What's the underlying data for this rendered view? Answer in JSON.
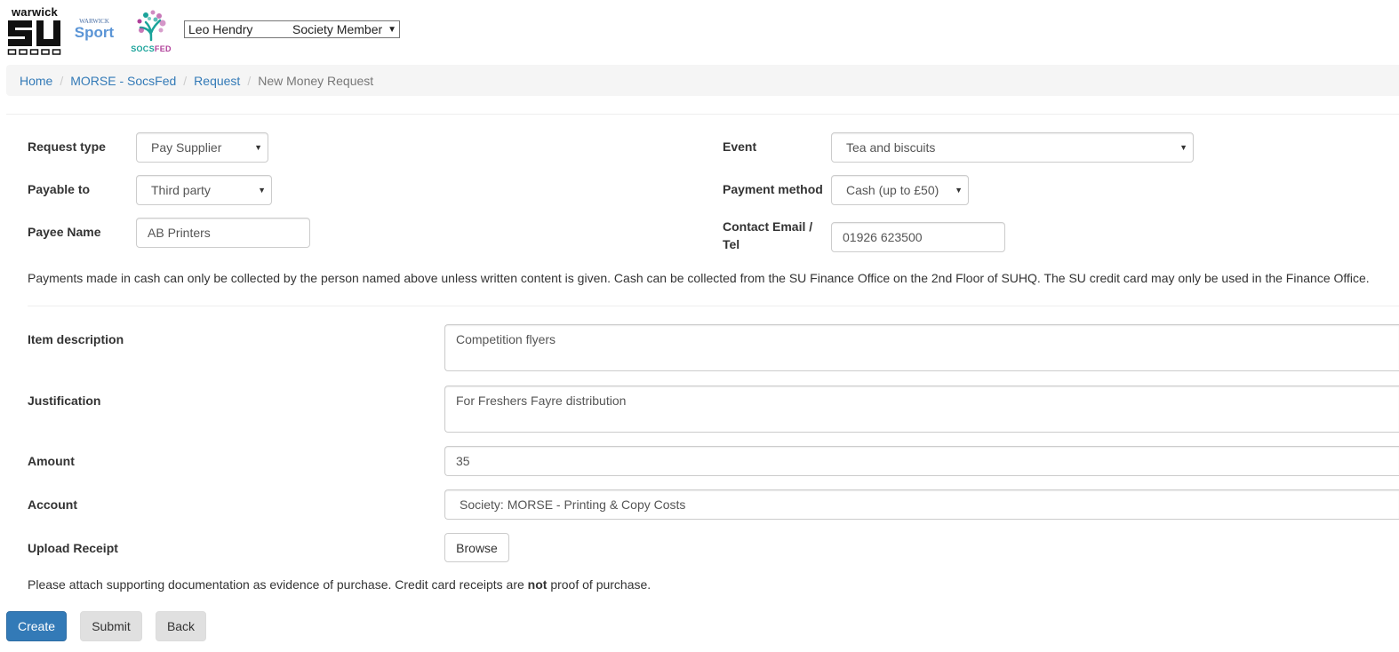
{
  "header": {
    "logos": {
      "su": {
        "top_text": "warwick",
        "main_text": "SU"
      },
      "sport": {
        "top_text": "WARWICK",
        "main_text": "Sport"
      },
      "socsfed": {
        "text_a": "SOCS",
        "text_b": "FED",
        "color_a": "#1aa39a",
        "color_b": "#b0409a"
      }
    },
    "user_select": {
      "name": "Leo Hendry",
      "role": "Society Member"
    }
  },
  "breadcrumb": {
    "items": [
      "Home",
      "MORSE - SocsFed",
      "Request"
    ],
    "active": "New Money Request",
    "separator": "/"
  },
  "form": {
    "request_type": {
      "label": "Request type",
      "value": "Pay Supplier"
    },
    "payable_to": {
      "label": "Payable to",
      "value": "Third party"
    },
    "payee_name": {
      "label": "Payee Name",
      "value": "AB Printers"
    },
    "event": {
      "label": "Event",
      "value": "Tea and biscuits"
    },
    "payment_method": {
      "label": "Payment method",
      "value": "Cash (up to £50)"
    },
    "contact": {
      "label_line1": "Contact Email /",
      "label_line2": "Tel",
      "value": "01926 623500"
    },
    "cash_note": "Payments made in cash can only be collected by the person named above unless written content is given. Cash can be collected from the SU Finance Office on the 2nd Floor of SUHQ. The SU credit card may only be used in the Finance Office.",
    "item_description": {
      "label": "Item description",
      "value": "Competition flyers"
    },
    "justification": {
      "label": "Justification",
      "value": "For Freshers Fayre distribution"
    },
    "amount": {
      "label": "Amount",
      "value": "35"
    },
    "account": {
      "label": "Account",
      "value": "Society: MORSE - Printing & Copy Costs"
    },
    "upload_receipt": {
      "label": "Upload Receipt",
      "button": "Browse"
    },
    "receipt_note": {
      "before": "Please attach supporting documentation as evidence of purchase. Credit card receipts are ",
      "bold": "not",
      "after": " proof of purchase."
    }
  },
  "actions": {
    "create": "Create",
    "submit": "Submit",
    "back": "Back"
  },
  "colors": {
    "primary": "#337ab7",
    "link": "#337ab7",
    "breadcrumb_bg": "#f5f5f5"
  }
}
